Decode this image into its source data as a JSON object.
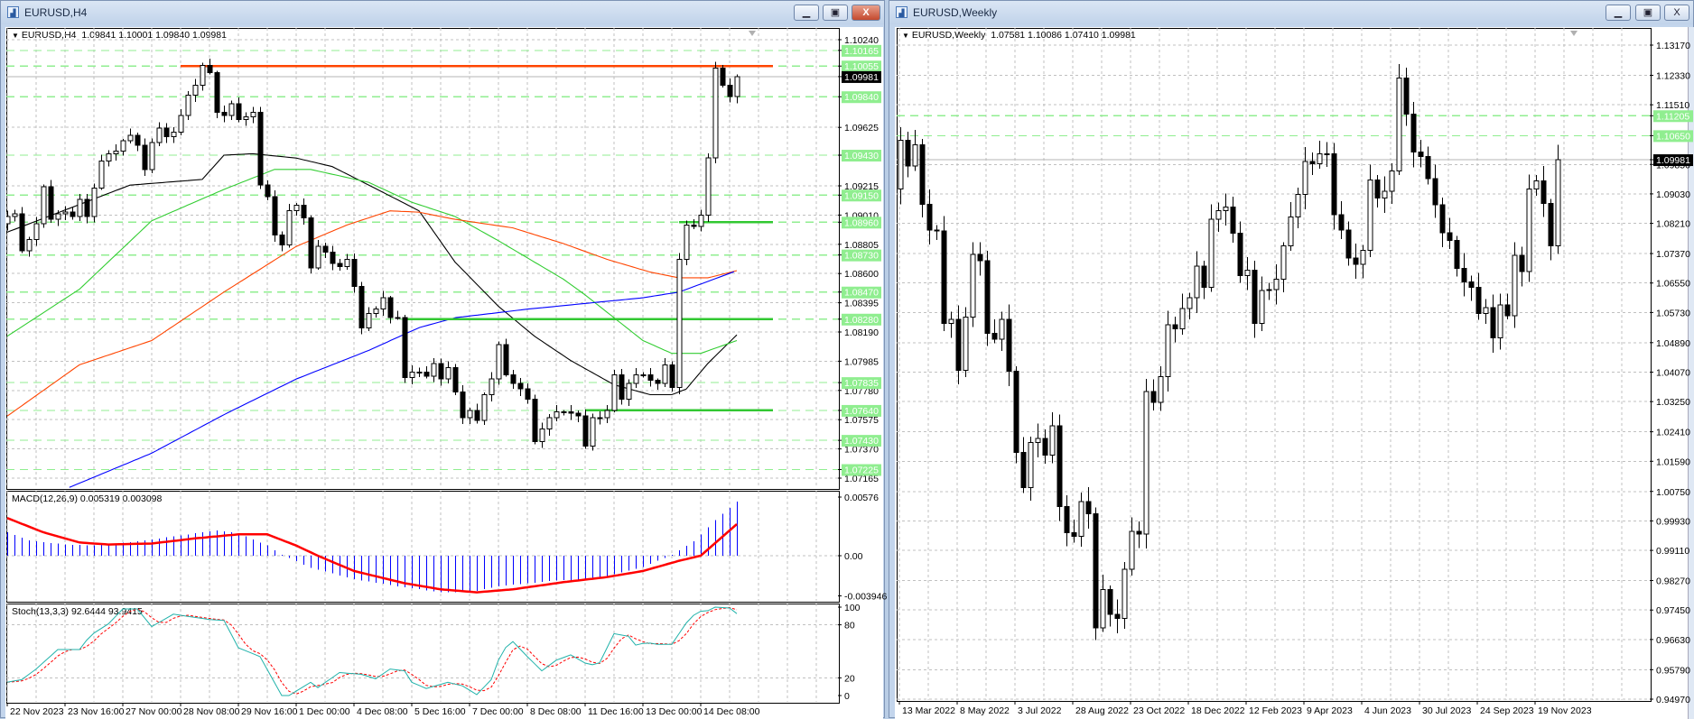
{
  "left_window": {
    "title": "EURUSD,H4",
    "icon": "chart-window-icon",
    "buttons": {
      "minimize": "▁",
      "restore": "▣",
      "close": "X"
    },
    "legend": {
      "arrow": "▼",
      "symbol": "EURUSD,H4",
      "ohlc": "1.09841 1.10001 1.09840 1.09981"
    },
    "macd_legend": "MACD(12,26,9) 0.005319 0.003098",
    "stoch_legend": "Stoch(13,3,3) 92.6444 93.9415"
  },
  "right_window": {
    "title": "EURUSD,Weekly",
    "icon": "chart-window-icon",
    "buttons": {
      "minimize": "▁",
      "restore": "▣",
      "close": "X"
    },
    "legend": {
      "arrow": "▼",
      "symbol": "EURUSD,Weekly",
      "ohlc": "1.07581 1.10086 1.07410 1.09981"
    }
  },
  "colors": {
    "level_green": "#90ee90",
    "solid_green": "#32c832",
    "resistance": "#ff4500",
    "ma_fast": "#000000",
    "ma_mid": "#32cd32",
    "ma_slow": "#ff4500",
    "ma_long": "#0000ff",
    "macd_hist": "#0000ff",
    "macd_signal": "#ff0000",
    "stoch_main": "#20b2aa",
    "stoch_signal": "#ff0000"
  },
  "chart_data": [
    {
      "type": "candlestick",
      "title": "EURUSD,H4",
      "ylim": [
        1.07165,
        1.1024
      ],
      "first_open": 1.0895,
      "closes": [
        1.09,
        1.0902,
        1.0876,
        1.0884,
        1.0895,
        1.0921,
        1.0898,
        1.0902,
        1.0903,
        1.09,
        1.0912,
        1.09,
        1.092,
        1.0939,
        1.0944,
        1.0946,
        1.0953,
        1.0957,
        1.095,
        1.0933,
        1.0952,
        1.0962,
        1.0956,
        1.0959,
        1.0971,
        1.0985,
        1.0992,
        1.1006,
        1.1001,
        1.0973,
        1.0971,
        1.0979,
        1.0968,
        1.097,
        1.0973,
        1.0922,
        1.0914,
        1.0887,
        1.088,
        1.0904,
        1.0908,
        1.0899,
        1.0864,
        1.0879,
        1.0875,
        1.0867,
        1.0865,
        1.087,
        1.0851,
        1.0822,
        1.0832,
        1.0835,
        1.0843,
        1.0829,
        1.0829,
        1.0787,
        1.0791,
        1.0791,
        1.0788,
        1.0797,
        1.0786,
        1.0794,
        1.0777,
        1.0759,
        1.0764,
        1.0757,
        1.0775,
        1.0786,
        1.081,
        1.0789,
        1.0783,
        1.0779,
        1.0772,
        1.0742,
        1.0751,
        1.0759,
        1.0763,
        1.0763,
        1.0762,
        1.076,
        1.0739,
        1.0759,
        1.0759,
        1.0764,
        1.0789,
        1.0772,
        1.0783,
        1.0789,
        1.0789,
        1.0785,
        1.0783,
        1.0796,
        1.078,
        1.087,
        1.0894,
        1.0893,
        1.0901,
        1.0941,
        1.1004,
        1.0992,
        1.09841,
        1.09981
      ],
      "price_ticks": [
        "1.10240",
        "1.09625",
        "1.09215",
        "1.09010",
        "1.08805",
        "1.08600",
        "1.08395",
        "1.08190",
        "1.07985",
        "1.07780",
        "1.07575",
        "1.07370",
        "1.07165"
      ],
      "levels": [
        "1.10165",
        "1.10055",
        "1.09840",
        "1.09430",
        "1.09150",
        "1.08960",
        "1.08730",
        "1.08470",
        "1.08280",
        "1.07835",
        "1.07640",
        "1.07430",
        "1.07225"
      ],
      "current_price": "1.09981",
      "resistance_line": {
        "price": 1.10055,
        "from": 24,
        "to": 106
      },
      "support_lines": [
        {
          "price": 1.0896,
          "from": 93,
          "to": 106
        },
        {
          "price": 1.0828,
          "from": 55,
          "to": 106
        },
        {
          "price": 1.0764,
          "from": 80,
          "to": 106
        }
      ],
      "moving_averages": [
        {
          "name": "ma-fast",
          "color": "#000000",
          "points": [
            [
              0,
              1.0889
            ],
            [
              17,
              1.0922
            ],
            [
              27,
              1.0926
            ],
            [
              30,
              1.0943
            ],
            [
              34,
              1.0944
            ],
            [
              40,
              1.0941
            ],
            [
              45,
              1.0935
            ],
            [
              52,
              1.0917
            ],
            [
              57,
              1.0904
            ],
            [
              62,
              1.0868
            ],
            [
              68,
              1.0837
            ],
            [
              73,
              1.0816
            ],
            [
              78,
              1.0799
            ],
            [
              84,
              1.0782
            ],
            [
              89,
              1.0775
            ],
            [
              92,
              1.0775
            ],
            [
              94,
              1.0779
            ],
            [
              97,
              1.0797
            ],
            [
              101,
              1.0817
            ]
          ]
        },
        {
          "name": "ma-mid",
          "color": "#32cd32",
          "points": [
            [
              0,
              1.0816
            ],
            [
              10,
              1.0849
            ],
            [
              20,
              1.0897
            ],
            [
              30,
              1.0919
            ],
            [
              37,
              1.0933
            ],
            [
              42,
              1.0933
            ],
            [
              50,
              1.0924
            ],
            [
              56,
              1.091
            ],
            [
              62,
              1.09
            ],
            [
              68,
              1.0883
            ],
            [
              73,
              1.0868
            ],
            [
              77,
              1.0856
            ],
            [
              80,
              1.0845
            ],
            [
              85,
              1.0825
            ],
            [
              88,
              1.0813
            ],
            [
              92,
              1.0804
            ],
            [
              96,
              1.0804
            ],
            [
              101,
              1.0813
            ]
          ]
        },
        {
          "name": "ma-slow",
          "color": "#ff4500",
          "points": [
            [
              0,
              1.076
            ],
            [
              10,
              1.0796
            ],
            [
              20,
              1.0813
            ],
            [
              30,
              1.0847
            ],
            [
              40,
              1.0879
            ],
            [
              47,
              1.0894
            ],
            [
              53,
              1.0904
            ],
            [
              57,
              1.0903
            ],
            [
              62,
              1.0898
            ],
            [
              70,
              1.0892
            ],
            [
              77,
              1.0881
            ],
            [
              83,
              1.087
            ],
            [
              89,
              1.0861
            ],
            [
              93,
              1.0857
            ],
            [
              97,
              1.0857
            ],
            [
              101,
              1.0862
            ]
          ]
        },
        {
          "name": "ma-long",
          "color": "#0000ff",
          "points": [
            [
              8.6,
              1.071
            ],
            [
              20,
              1.0734
            ],
            [
              30,
              1.0761
            ],
            [
              40,
              1.0786
            ],
            [
              50,
              1.0806
            ],
            [
              57,
              1.0822
            ],
            [
              62,
              1.0829
            ],
            [
              72,
              1.0835
            ],
            [
              80,
              1.0839
            ],
            [
              88,
              1.0843
            ],
            [
              93,
              1.0847
            ],
            [
              101,
              1.0862
            ]
          ]
        }
      ],
      "x_tick_labels": [
        "22 Nov 2023",
        "23 Nov 16:00",
        "27 Nov 00:00",
        "28 Nov 08:00",
        "29 Nov 16:00",
        "1 Dec 00:00",
        "4 Dec 08:00",
        "5 Dec 16:00",
        "7 Dec 00:00",
        "8 Dec 08:00",
        "11 Dec 16:00",
        "13 Dec 00:00",
        "14 Dec 08:00"
      ]
    },
    {
      "type": "bar",
      "title": "MACD(12,26,9)",
      "ylim": [
        -0.003946,
        0.00576
      ],
      "y_ticks": [
        "0.00576",
        "0.00",
        "-0.003946"
      ],
      "macd_points": [
        [
          0,
          0.0023
        ],
        [
          3,
          0.0015
        ],
        [
          8,
          0.0011
        ],
        [
          12,
          0.001
        ],
        [
          18,
          0.0014
        ],
        [
          24,
          0.002
        ],
        [
          29,
          0.0025
        ],
        [
          32,
          0.0022
        ],
        [
          36,
          0.001
        ],
        [
          38,
          0.0001
        ],
        [
          42,
          -0.0012
        ],
        [
          48,
          -0.0023
        ],
        [
          54,
          -0.003
        ],
        [
          60,
          -0.0036
        ],
        [
          64,
          -0.0036
        ],
        [
          68,
          -0.003
        ],
        [
          75,
          -0.0025
        ],
        [
          82,
          -0.0022
        ],
        [
          88,
          -0.0011
        ],
        [
          92,
          0.0001
        ],
        [
          95,
          0.0014
        ],
        [
          98,
          0.0035
        ],
        [
          101,
          0.005319
        ]
      ],
      "signal_points": [
        [
          0,
          0.0037
        ],
        [
          5,
          0.0023
        ],
        [
          10,
          0.0013
        ],
        [
          14,
          0.0011
        ],
        [
          20,
          0.0012
        ],
        [
          26,
          0.0017
        ],
        [
          32,
          0.0021
        ],
        [
          36,
          0.0021
        ],
        [
          40,
          0.001
        ],
        [
          43,
          0.0
        ],
        [
          48,
          -0.0015
        ],
        [
          55,
          -0.0027
        ],
        [
          60,
          -0.0033
        ],
        [
          65,
          -0.0036
        ],
        [
          70,
          -0.0033
        ],
        [
          77,
          -0.0026
        ],
        [
          83,
          -0.0021
        ],
        [
          88,
          -0.0015
        ],
        [
          93,
          -0.0005
        ],
        [
          96,
          0.0
        ],
        [
          101,
          0.003098
        ]
      ]
    },
    {
      "type": "line",
      "title": "Stoch(13,3,3)",
      "ylim": [
        0,
        100
      ],
      "y_ticks": [
        "100",
        "80",
        "20",
        "0"
      ],
      "k_points": [
        [
          0,
          15
        ],
        [
          2,
          18
        ],
        [
          4,
          30
        ],
        [
          7,
          52
        ],
        [
          10,
          52
        ],
        [
          11.5,
          68
        ],
        [
          14,
          81
        ],
        [
          16,
          98
        ],
        [
          18,
          98
        ],
        [
          20,
          78
        ],
        [
          23,
          92
        ],
        [
          28,
          86
        ],
        [
          30,
          85
        ],
        [
          32,
          54
        ],
        [
          35,
          44
        ],
        [
          38,
          0
        ],
        [
          39,
          0
        ],
        [
          42,
          15
        ],
        [
          43,
          9
        ],
        [
          46,
          26
        ],
        [
          49,
          24
        ],
        [
          51,
          19
        ],
        [
          53,
          30
        ],
        [
          55,
          28
        ],
        [
          56,
          15
        ],
        [
          58,
          8
        ],
        [
          61,
          15
        ],
        [
          63,
          11
        ],
        [
          65,
          1
        ],
        [
          67,
          18
        ],
        [
          68.5,
          51
        ],
        [
          70,
          61
        ],
        [
          72,
          44
        ],
        [
          74,
          28
        ],
        [
          76,
          40
        ],
        [
          78,
          46
        ],
        [
          80.6,
          34
        ],
        [
          82,
          37
        ],
        [
          84,
          70
        ],
        [
          86,
          67
        ],
        [
          87,
          57
        ],
        [
          88.5,
          60
        ],
        [
          90,
          58
        ],
        [
          92,
          58
        ],
        [
          94,
          82
        ],
        [
          95.5,
          95
        ],
        [
          97,
          96
        ],
        [
          98,
          100
        ],
        [
          100,
          99
        ],
        [
          101,
          92.6444
        ]
      ]
    },
    {
      "type": "candlestick",
      "title": "EURUSD,Weekly",
      "ylim": [
        0.9497,
        1.1317
      ],
      "first_open": 1.0916,
      "closes": [
        1.1052,
        1.0981,
        1.104,
        1.0874,
        1.0803,
        1.08,
        1.0542,
        1.0554,
        1.0412,
        1.056,
        1.0734,
        1.0717,
        1.0515,
        1.0499,
        1.0554,
        1.041,
        1.0184,
        1.0086,
        1.0211,
        1.0223,
        1.0176,
        1.0258,
        1.0033,
        0.996,
        0.995,
        1.0047,
        1.0013,
        0.9695,
        0.9802,
        0.9733,
        0.9722,
        0.9859,
        0.9964,
        0.9956,
        1.0353,
        1.0323,
        1.0394,
        1.0539,
        1.0527,
        1.0584,
        1.0614,
        1.0702,
        1.0643,
        1.0833,
        1.0856,
        1.0866,
        1.0794,
        1.0675,
        1.0691,
        1.0542,
        1.0634,
        1.0637,
        1.0665,
        1.0758,
        1.0839,
        1.0902,
        1.0993,
        1.0987,
        1.1015,
        1.1015,
        1.0845,
        1.0803,
        1.0724,
        1.0707,
        1.0746,
        1.0942,
        1.0892,
        1.091,
        1.0967,
        1.1226,
        1.1125,
        1.1019,
        1.1007,
        1.0945,
        1.0873,
        1.0795,
        1.0774,
        1.0696,
        1.0658,
        1.0643,
        1.057,
        1.0586,
        1.0503,
        1.0594,
        1.0564,
        1.0732,
        1.0687,
        1.0916,
        1.0939,
        1.0877,
        1.07581,
        1.09981
      ],
      "price_ticks": [
        "1.13170",
        "1.12330",
        "1.11510",
        "1.09850",
        "1.09030",
        "1.08210",
        "1.07370",
        "1.06550",
        "1.05730",
        "1.04890",
        "1.04070",
        "1.03250",
        "1.02410",
        "1.01590",
        "1.00750",
        "0.99930",
        "0.99110",
        "0.98270",
        "0.97450",
        "0.96630",
        "0.95790",
        "0.94970"
      ],
      "levels": [
        "1.11205",
        "1.10650"
      ],
      "current_price": "1.09981",
      "x_tick_labels": [
        "13 Mar 2022",
        "8 May 2022",
        "3 Jul 2022",
        "28 Aug 2022",
        "23 Oct 2022",
        "18 Dec 2022",
        "12 Feb 2023",
        "9 Apr 2023",
        "4 Jun 2023",
        "30 Jul 2023",
        "24 Sep 2023",
        "19 Nov 2023"
      ]
    }
  ]
}
